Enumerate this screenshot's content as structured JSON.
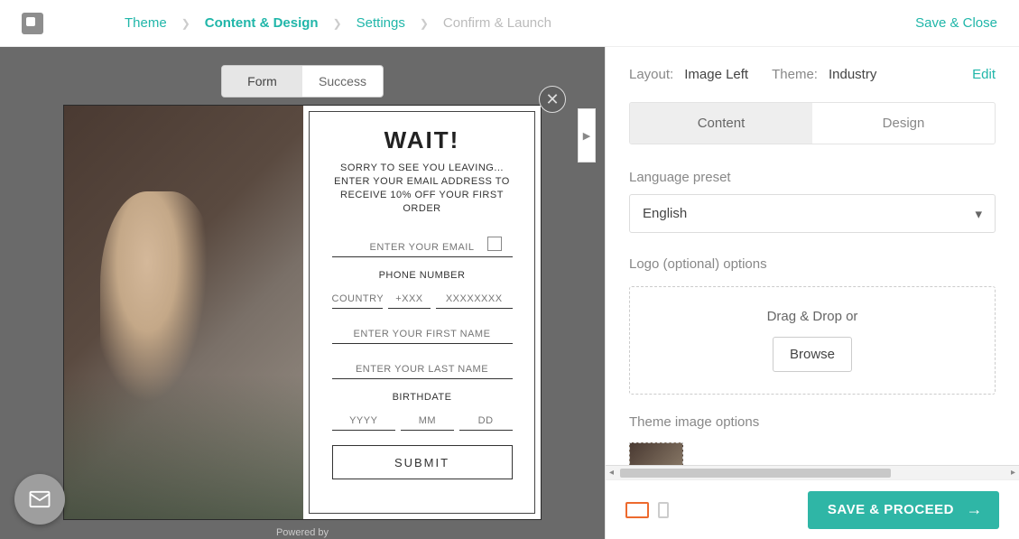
{
  "breadcrumbs": {
    "theme": "Theme",
    "content": "Content & Design",
    "settings": "Settings",
    "confirm": "Confirm & Launch"
  },
  "save_close": "Save & Close",
  "preview_tabs": {
    "form": "Form",
    "success": "Success"
  },
  "modal": {
    "title": "WAIT!",
    "subtitle": "SORRY TO SEE YOU LEAVING... ENTER YOUR EMAIL ADDRESS TO RECEIVE 10% OFF YOUR FIRST ORDER",
    "email_ph": "ENTER YOUR EMAIL",
    "phone_lbl": "PHONE NUMBER",
    "country_ph": "COUNTRY▾",
    "code_ph": "+XXX",
    "phone_ph": "XXXXXXXX",
    "fname_ph": "ENTER YOUR FIRST NAME",
    "lname_ph": "ENTER YOUR LAST NAME",
    "bday_lbl": "BIRTHDATE",
    "yyyy": "YYYY",
    "mm": "MM",
    "dd": "DD",
    "submit": "SUBMIT"
  },
  "powered": "Powered by",
  "panel": {
    "layout_lbl": "Layout:",
    "layout_val": "Image Left",
    "theme_lbl": "Theme:",
    "theme_val": "Industry",
    "edit": "Edit",
    "tab_content": "Content",
    "tab_design": "Design",
    "lang_lbl": "Language preset",
    "lang_val": "English",
    "logo_lbl": "Logo (optional) options",
    "drop": "Drag & Drop or",
    "browse": "Browse",
    "themeimg_lbl": "Theme image options"
  },
  "footer": {
    "proceed": "SAVE & PROCEED"
  }
}
